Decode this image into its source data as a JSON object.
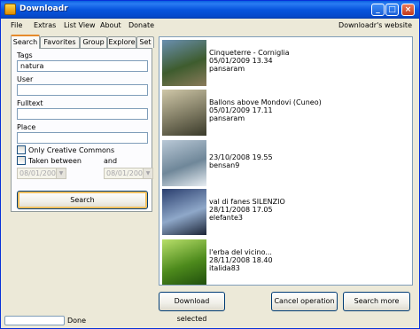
{
  "window": {
    "title": "Downloadr"
  },
  "menu": {
    "items": [
      "File",
      "Extras",
      "List View",
      "About",
      "Donate"
    ],
    "right_link": "Downloadr's website"
  },
  "tabs": [
    "Search",
    "Favorites",
    "Group",
    "Explore",
    "Set"
  ],
  "search": {
    "tags_label": "Tags",
    "tags_value": "natura",
    "user_label": "User",
    "user_value": "",
    "fulltext_label": "Fulltext",
    "fulltext_value": "",
    "place_label": "Place",
    "place_value": "",
    "only_cc_label": "Only Creative Commons",
    "taken_between_label": "Taken between",
    "and_label": "and",
    "date_from": "08/01/2009",
    "date_to": "08/01/2009",
    "search_button": "Search"
  },
  "results": [
    {
      "title": "Cinqueterre - Corniglia",
      "date": "05/01/2009 13.34",
      "user": "pansaram",
      "thumb_colors": [
        "#6a8fb0",
        "#3e5c2e",
        "#8a7a5a"
      ]
    },
    {
      "title": "Ballons above Mondovi (Cuneo)",
      "date": "05/01/2009 17.11",
      "user": "pansaram",
      "thumb_colors": [
        "#cfc7a8",
        "#7e7a62",
        "#3a3a2a"
      ]
    },
    {
      "title": "23/10/2008 19.55",
      "date": "bensan9",
      "user": "",
      "thumb_colors": [
        "#b9c8d6",
        "#6f8799",
        "#e8eef3"
      ]
    },
    {
      "title": "val di fanes SILENZIO",
      "date": "28/11/2008 17.05",
      "user": "elefante3",
      "thumb_colors": [
        "#2a3e6e",
        "#8fa8c9",
        "#1b2436"
      ]
    },
    {
      "title": "l'erba del vicino...",
      "date": "28/11/2008 18.40",
      "user": "italida83",
      "thumb_colors": [
        "#b8df6a",
        "#4d8a1c",
        "#1f4d0c"
      ]
    }
  ],
  "actions": {
    "download_selected": "Download selected",
    "cancel_operation": "Cancel operation",
    "search_more": "Search more"
  },
  "status": {
    "text": "Done",
    "progress": 0
  }
}
